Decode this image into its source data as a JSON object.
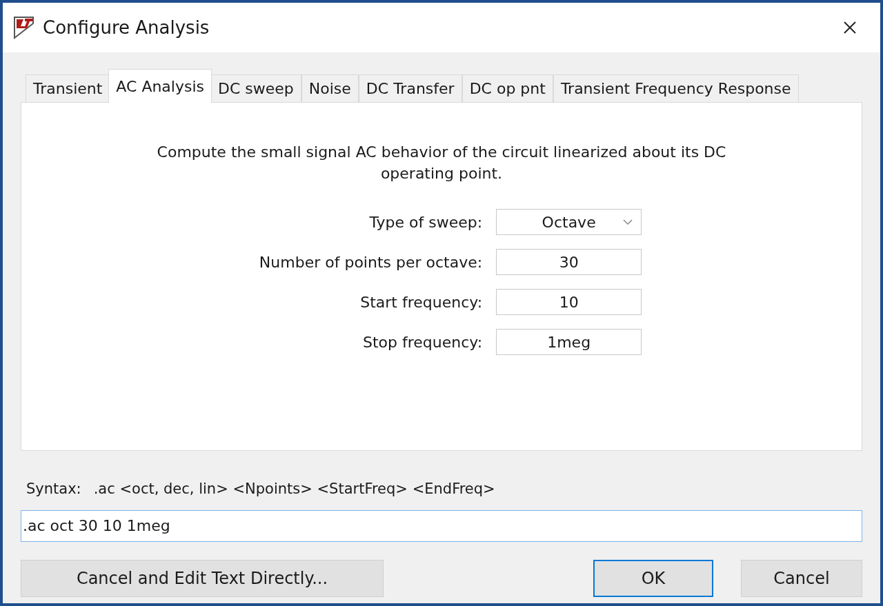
{
  "window": {
    "title": "Configure Analysis"
  },
  "tabs": [
    {
      "label": "Transient",
      "selected": false
    },
    {
      "label": "AC Analysis",
      "selected": true
    },
    {
      "label": "DC sweep",
      "selected": false
    },
    {
      "label": "Noise",
      "selected": false
    },
    {
      "label": "DC Transfer",
      "selected": false
    },
    {
      "label": "DC op pnt",
      "selected": false
    },
    {
      "label": "Transient Frequency Response",
      "selected": false
    }
  ],
  "description": "Compute the small signal AC behavior of the circuit linearized about its DC operating point.",
  "fields": [
    {
      "label": "Type of sweep:",
      "kind": "select",
      "value": "Octave"
    },
    {
      "label": "Number of points per octave:",
      "kind": "text",
      "value": "30"
    },
    {
      "label": "Start frequency:",
      "kind": "text",
      "value": "10"
    },
    {
      "label": "Stop frequency:",
      "kind": "text",
      "value": "1meg"
    }
  ],
  "syntax": {
    "label": "Syntax:",
    "text": ".ac <oct, dec, lin> <Npoints> <StartFreq> <EndFreq>"
  },
  "command": {
    "value": ".ac oct 30 10 1meg"
  },
  "buttons": [
    {
      "label": "Cancel and Edit Text Directly...",
      "default": false
    },
    {
      "label": "OK",
      "default": true
    },
    {
      "label": "Cancel",
      "default": false
    }
  ]
}
